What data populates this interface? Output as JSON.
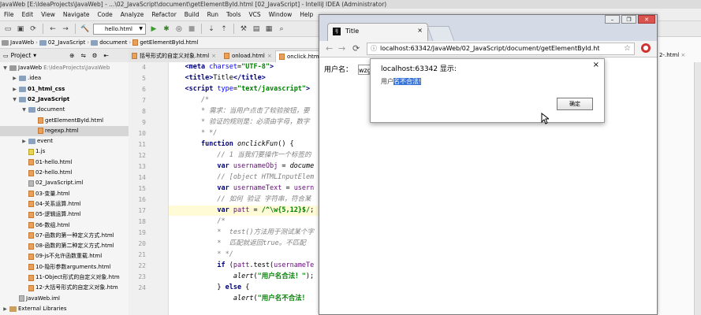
{
  "ide": {
    "title": "JavaWeb [E:\\IdeaProjects\\JavaWeb] - ...\\02_JavaScript\\document\\getElementById.html [02_JavaScript] - IntelliJ IDEA (Administrator)",
    "menu": [
      "File",
      "Edit",
      "View",
      "Navigate",
      "Code",
      "Analyze",
      "Refactor",
      "Build",
      "Run",
      "Tools",
      "VCS",
      "Window",
      "Help"
    ],
    "run_config": "hello.html",
    "breadcrumbs": [
      "JavaWeb",
      "02_JavaScript",
      "document",
      "getElementById.html"
    ],
    "project_panel": {
      "label": "Project",
      "tree": [
        {
          "label": "JavaWeb",
          "suffix": "E:\\IdeaProjects\\JavaWeb",
          "level": 0,
          "icon": "folder",
          "expanded": true
        },
        {
          "label": ".idea",
          "level": 1,
          "icon": "folder",
          "expanded": false
        },
        {
          "label": "01_html_css",
          "level": 1,
          "icon": "folder",
          "expanded": false,
          "bold": true
        },
        {
          "label": "02_JavaScript",
          "level": 1,
          "icon": "folder",
          "expanded": true,
          "bold": true
        },
        {
          "label": "document",
          "level": 2,
          "icon": "folder",
          "expanded": true
        },
        {
          "label": "getElementById.html",
          "level": 3,
          "icon": "html"
        },
        {
          "label": "regexp.html",
          "level": 3,
          "icon": "html",
          "selected": true
        },
        {
          "label": "event",
          "level": 2,
          "icon": "folder",
          "expanded": false
        },
        {
          "label": "1.js",
          "level": 2,
          "icon": "js"
        },
        {
          "label": "01-hello.html",
          "level": 2,
          "icon": "html"
        },
        {
          "label": "02-hello.html",
          "level": 2,
          "icon": "html"
        },
        {
          "label": "02_JavaScript.iml",
          "level": 2,
          "icon": "iml"
        },
        {
          "label": "03-变量.html",
          "level": 2,
          "icon": "html"
        },
        {
          "label": "04-关系运算.html",
          "level": 2,
          "icon": "html"
        },
        {
          "label": "05-逻辑运算.html",
          "level": 2,
          "icon": "html"
        },
        {
          "label": "06-数组.html",
          "level": 2,
          "icon": "html"
        },
        {
          "label": "07-函数的第一种定义方式.html",
          "level": 2,
          "icon": "html"
        },
        {
          "label": "08-函数的第二种定义方式.html",
          "level": 2,
          "icon": "html"
        },
        {
          "label": "09-js不允许函数重载.html",
          "level": 2,
          "icon": "html"
        },
        {
          "label": "10-隐形参数arguments.html",
          "level": 2,
          "icon": "html"
        },
        {
          "label": "11-Object形式的自定义对象.htm",
          "level": 2,
          "icon": "html"
        },
        {
          "label": "12-大括号形式的自定义对象.htm",
          "level": 2,
          "icon": "html"
        },
        {
          "label": "JavaWeb.iml",
          "level": 1,
          "icon": "iml"
        },
        {
          "label": "External Libraries",
          "level": 0,
          "icon": "lib",
          "expanded": false
        }
      ]
    },
    "editor_tabs": [
      {
        "label": "括号形式的自定义对象.html",
        "active": false
      },
      {
        "label": "onload.html",
        "active": false
      },
      {
        "label": "onclick.html",
        "active": true
      }
    ],
    "right_tab": "2-.html",
    "code": {
      "line_numbers": [
        "4",
        "5",
        "6",
        "7",
        "8",
        "9",
        "10",
        "11",
        "12",
        "13",
        "14",
        "15",
        "16",
        "17",
        "18",
        "19",
        "20",
        "21",
        "22",
        "23",
        "24"
      ],
      "highlight_line": 13
    }
  },
  "browser": {
    "tab_title": "Title",
    "url": "localhost:63342/JavaWeb/02_JavaScript/document/getElementById.ht",
    "page_label": "用户名：",
    "page_input_value": "wzg",
    "alert": {
      "title": "localhost:63342 显示:",
      "message_prefix": "用户",
      "message_selected": "名不合法!",
      "ok_label": "确定"
    }
  },
  "colors": {
    "keyword": "#000080",
    "string": "#008000",
    "comment": "#808080",
    "variable": "#660e7a",
    "selection": "#3874d8"
  }
}
